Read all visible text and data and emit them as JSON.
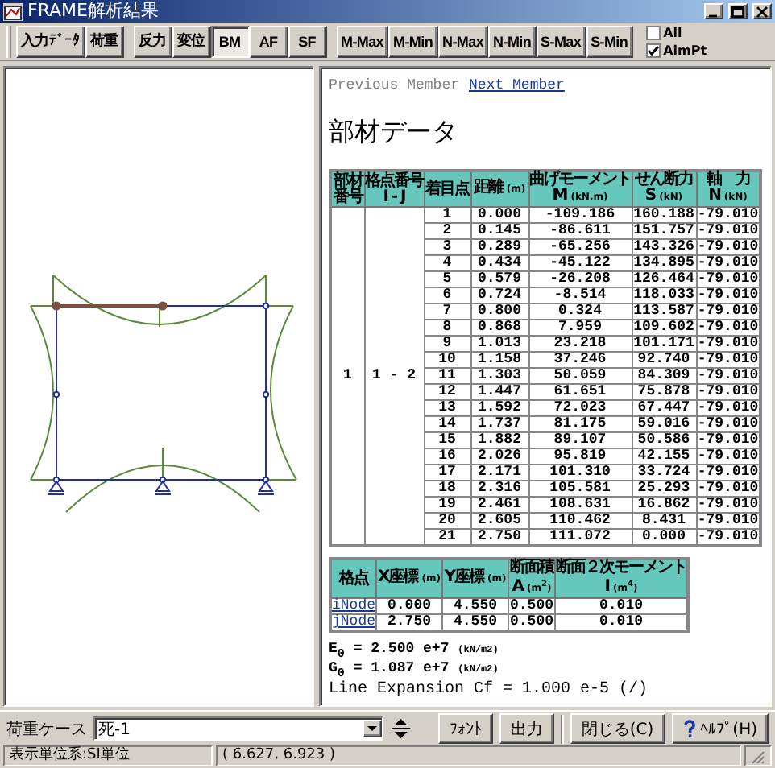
{
  "window": {
    "title": "FRAME解析結果"
  },
  "toolbar": {
    "groups": [
      {
        "buttons": [
          {
            "label": "入力ﾃﾞｰﾀ",
            "selected": false
          },
          {
            "label": "荷重",
            "selected": false
          }
        ]
      },
      {
        "buttons": [
          {
            "label": "反力",
            "selected": false
          },
          {
            "label": "変位",
            "selected": false
          },
          {
            "label": "BM",
            "selected": true
          },
          {
            "label": "AF",
            "selected": false
          },
          {
            "label": "SF",
            "selected": false
          }
        ]
      },
      {
        "buttons": [
          {
            "label": "M-Max",
            "selected": false
          },
          {
            "label": "M-Min",
            "selected": false
          },
          {
            "label": "N-Max",
            "selected": false
          },
          {
            "label": "N-Min",
            "selected": false
          },
          {
            "label": "S-Max",
            "selected": false
          },
          {
            "label": "S-Min",
            "selected": false
          }
        ]
      }
    ],
    "checkboxes": [
      {
        "label": "All",
        "checked": false
      },
      {
        "label": "AimPt",
        "checked": true
      }
    ]
  },
  "nav": [
    {
      "label": "Previous Member",
      "disabled": true
    },
    {
      "label": "Next Member",
      "disabled": false
    }
  ],
  "report": {
    "heading": "部材データ",
    "member_table": {
      "columns": [
        {
          "label": "部材",
          "sub": "番号"
        },
        {
          "label": "格点番号",
          "sub": "I - J"
        },
        {
          "label": "着目点"
        },
        {
          "label": "距離",
          "unit": "(m)"
        },
        {
          "label": "曲げモーメント",
          "sub": "M",
          "unit": "(kN.m)"
        },
        {
          "label": "せん断力",
          "sub": "S",
          "unit": "(kN)"
        },
        {
          "label": "軸　力",
          "sub": "N",
          "unit": "(kN)"
        }
      ],
      "rows": [
        [
          "",
          "",
          "1",
          "0.000",
          "-109.186",
          "160.188",
          "-79.010"
        ],
        [
          "",
          "",
          "2",
          "0.145",
          "-86.611",
          "151.757",
          "-79.010"
        ],
        [
          "",
          "",
          "3",
          "0.289",
          "-65.256",
          "143.326",
          "-79.010"
        ],
        [
          "",
          "",
          "4",
          "0.434",
          "-45.122",
          "134.895",
          "-79.010"
        ],
        [
          "",
          "",
          "5",
          "0.579",
          "-26.208",
          "126.464",
          "-79.010"
        ],
        [
          "",
          "",
          "6",
          "0.724",
          "-8.514",
          "118.033",
          "-79.010"
        ],
        [
          "",
          "",
          "7",
          "0.800",
          "0.324",
          "113.587",
          "-79.010"
        ],
        [
          "",
          "",
          "8",
          "0.868",
          "7.959",
          "109.602",
          "-79.010"
        ],
        [
          "",
          "",
          "9",
          "1.013",
          "23.218",
          "101.171",
          "-79.010"
        ],
        [
          "",
          "",
          "10",
          "1.158",
          "37.246",
          "92.740",
          "-79.010"
        ],
        [
          "1",
          "1 - 2",
          "11",
          "1.303",
          "50.059",
          "84.309",
          "-79.010"
        ],
        [
          "",
          "",
          "12",
          "1.447",
          "61.651",
          "75.878",
          "-79.010"
        ],
        [
          "",
          "",
          "13",
          "1.592",
          "72.023",
          "67.447",
          "-79.010"
        ],
        [
          "",
          "",
          "14",
          "1.737",
          "81.175",
          "59.016",
          "-79.010"
        ],
        [
          "",
          "",
          "15",
          "1.882",
          "89.107",
          "50.586",
          "-79.010"
        ],
        [
          "",
          "",
          "16",
          "2.026",
          "95.819",
          "42.155",
          "-79.010"
        ],
        [
          "",
          "",
          "17",
          "2.171",
          "101.310",
          "33.724",
          "-79.010"
        ],
        [
          "",
          "",
          "18",
          "2.316",
          "105.581",
          "25.293",
          "-79.010"
        ],
        [
          "",
          "",
          "19",
          "2.461",
          "108.631",
          "16.862",
          "-79.010"
        ],
        [
          "",
          "",
          "20",
          "2.605",
          "110.462",
          "8.431",
          "-79.010"
        ],
        [
          "",
          "",
          "21",
          "2.750",
          "111.072",
          "0.000",
          "-79.010"
        ]
      ]
    },
    "node_table": {
      "columns": [
        {
          "label": "格点"
        },
        {
          "label": "X座標",
          "unit": "(m)"
        },
        {
          "label": "Y座標",
          "unit": "(m)"
        },
        {
          "label": "断面積",
          "sub": "A",
          "unit": "(m$^{2}$)"
        },
        {
          "label": "断面２次モーメント",
          "sub": "I",
          "unit": "(m$^{4}$)"
        }
      ],
      "rows": [
        [
          "iNode",
          "0.000",
          "4.550",
          "0.500",
          "0.010"
        ],
        [
          "jNode",
          "2.750",
          "4.550",
          "0.500",
          "0.010"
        ]
      ]
    },
    "constants": [
      {
        "text": "E$_{0}$ = 2.500 e+7",
        "unit": "(kN/m2)"
      },
      {
        "text": "G$_{0}$ = 1.087 e+7",
        "unit": "(kN/m2)"
      },
      {
        "text": "Line Expansion Cf = 1.000 e-5 (/)"
      }
    ]
  },
  "load_case": {
    "label": "荷重ケース",
    "value": "死-1"
  },
  "buttons": [
    {
      "label": "ﾌｫﾝﾄ",
      "kind": "plain"
    },
    {
      "label": "出力",
      "kind": "plain"
    },
    {
      "label": "閉じる(C)",
      "kind": "plain"
    },
    {
      "label": "ﾍﾙﾌﾟ(H)",
      "kind": "help"
    }
  ],
  "status_bar": [
    "表示単位系:SI単位",
    "( 6.627, 6.923 )"
  ]
}
